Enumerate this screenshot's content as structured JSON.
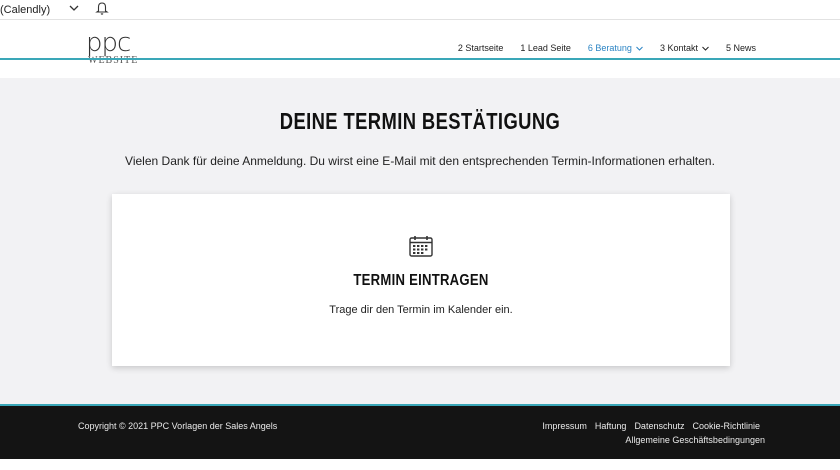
{
  "topbar": {
    "context_text": "(Calendly)"
  },
  "header": {
    "logo_mark": "ppc",
    "logo_sub": "WEBSITE",
    "nav": [
      {
        "label": "2 Startseite",
        "has_caret": false,
        "active": false
      },
      {
        "label": "1 Lead Seite",
        "has_caret": false,
        "active": false
      },
      {
        "label": "6 Beratung",
        "has_caret": true,
        "active": true
      },
      {
        "label": "3 Kontakt",
        "has_caret": true,
        "active": false
      },
      {
        "label": "5 News",
        "has_caret": false,
        "active": false
      }
    ]
  },
  "main": {
    "title": "DEINE TERMIN BESTÄTIGUNG",
    "thanks": "Vielen Dank für deine Anmeldung. Du wirst eine E-Mail mit den entsprechenden Termin-Informationen erhalten.",
    "card": {
      "icon": "calendar-icon",
      "title": "TERMIN EINTRAGEN",
      "text": "Trage dir den Termin im Kalender ein."
    }
  },
  "footer": {
    "copyright": "Copyright © 2021 PPC Vorlagen der Sales Angels",
    "links": [
      "Impressum",
      "Haftung",
      "Datenschutz",
      "Cookie-Richtlinie"
    ],
    "agb": "Allgemeine Geschäftsbedingungen"
  },
  "colors": {
    "accent": "#3aa7b8",
    "nav_active": "#2b84c4",
    "footer_bg": "#141414",
    "main_bg": "#f2f2f4"
  }
}
